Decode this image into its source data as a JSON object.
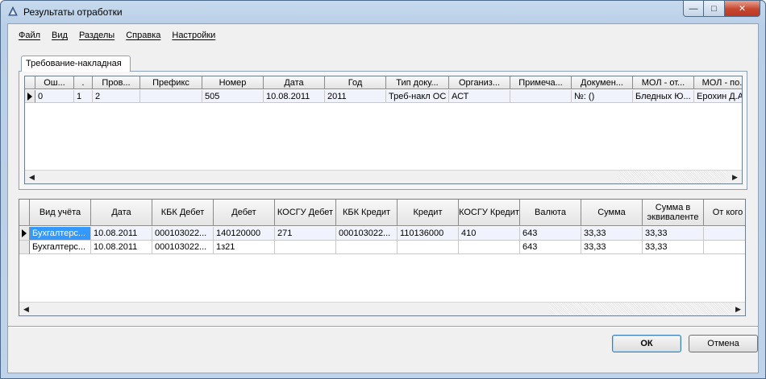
{
  "window": {
    "title": "Результаты отработки"
  },
  "menu": [
    "Файл",
    "Вид",
    "Разделы",
    "Справка",
    "Настройки"
  ],
  "tab": {
    "label": "Требование-накладная"
  },
  "grid1": {
    "headers": [
      "Ош...",
      ".",
      "Пров...",
      "Префикс",
      "Номер",
      "Дата",
      "Год",
      "Тип доку...",
      "Организ...",
      "Примеча...",
      "Докумен...",
      "МОЛ - от...",
      "МОЛ - по..."
    ],
    "rows": [
      [
        "0",
        "1",
        "2",
        "",
        "505",
        "10.08.2011",
        "2011",
        "Треб-накл ОС",
        "АСТ",
        "",
        "№: ()",
        "Бледных Ю...",
        "Ерохин Д.А"
      ]
    ]
  },
  "grid2": {
    "headers": [
      "Вид учёта",
      "Дата",
      "КБК Дебет",
      "Дебет",
      "КОСГУ Дебет",
      "КБК Кредит",
      "Кредит",
      "КОСГУ Кредит",
      "Валюта",
      "Сумма",
      "Сумма в эквиваленте",
      "От кого"
    ],
    "rows": [
      [
        "Бухгалтерс...",
        "10.08.2011",
        "000103022...",
        "140120000",
        "271",
        "000103022...",
        "110136000",
        "410",
        "643",
        "33,33",
        "33,33",
        ""
      ],
      [
        "Бухгалтерс...",
        "10.08.2011",
        "000103022...",
        "1з21",
        "",
        "",
        "",
        "",
        "643",
        "33,33",
        "33,33",
        ""
      ]
    ]
  },
  "buttons": {
    "ok": "ОК",
    "cancel": "Отмена"
  },
  "icons": {
    "minimize": "minimize-icon",
    "maximize": "maximize-icon",
    "close": "close-icon",
    "app": "app-icon"
  }
}
